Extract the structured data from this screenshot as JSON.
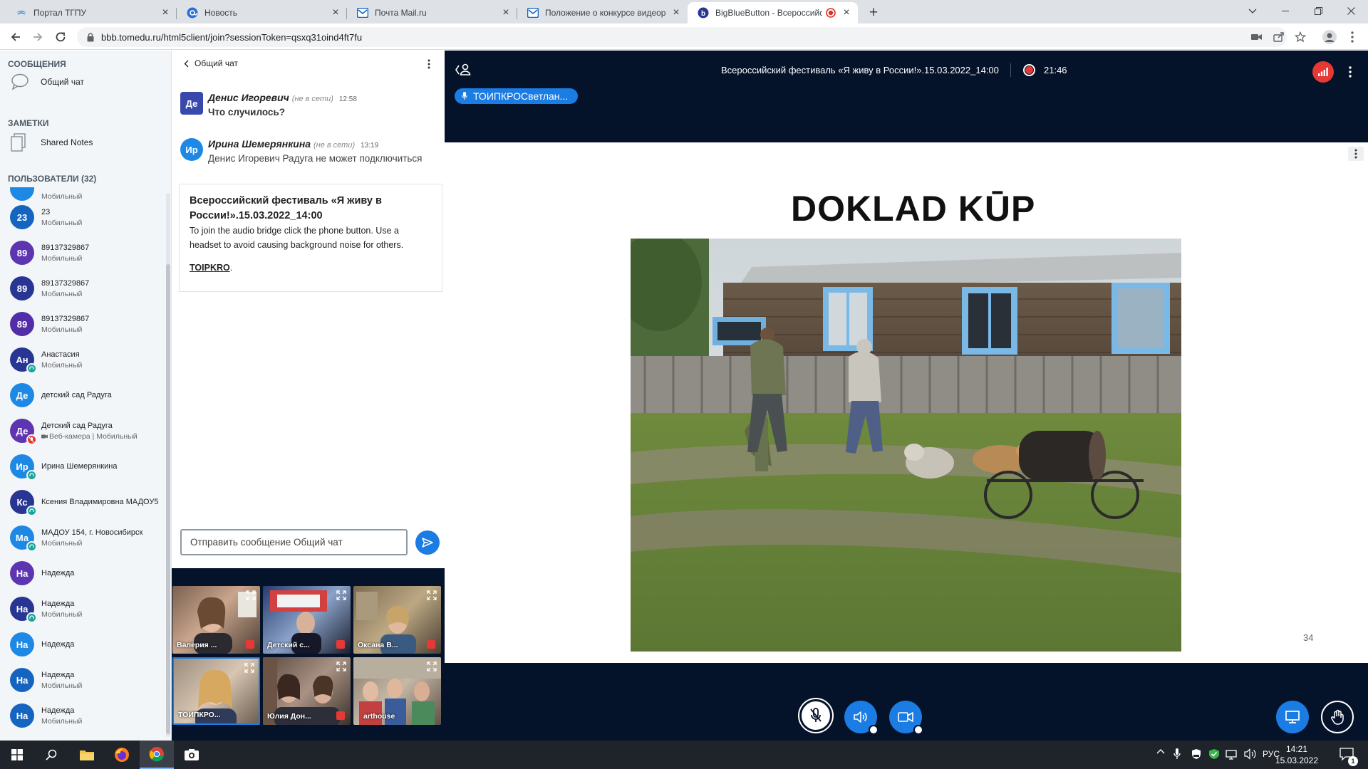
{
  "browser": {
    "tabs": [
      {
        "title": "Портал ТГПУ"
      },
      {
        "title": "Новость"
      },
      {
        "title": "Почта Mail.ru"
      },
      {
        "title": "Положение о конкурсе видеор"
      },
      {
        "title": "BigBlueButton - Всероссийс",
        "active": true
      }
    ],
    "url": "bbb.tomedu.ru/html5client/join?sessionToken=qsxq31oind4ft7fu"
  },
  "sidebar": {
    "messages_header": "СООБЩЕНИЯ",
    "public_chat": "Общий чат",
    "notes_header": "ЗАМЕТКИ",
    "shared_notes": "Shared Notes",
    "users_header": "ПОЛЬЗОВАТЕЛИ (32)",
    "users": [
      {
        "initials": "23",
        "name": "23",
        "status": "Мобильный",
        "color": "#1565c0"
      },
      {
        "initials": "89",
        "name": "89137329867",
        "status": "Мобильный",
        "color": "#5e35b1"
      },
      {
        "initials": "89",
        "name": "89137329867",
        "status": "Мобильный",
        "color": "#283593"
      },
      {
        "initials": "89",
        "name": "89137329867",
        "status": "Мобильный",
        "color": "#512da8"
      },
      {
        "initials": "Ан",
        "name": "Анастасия",
        "status": "Мобильный",
        "color": "#283593",
        "badge": "listen"
      },
      {
        "initials": "Де",
        "name": "детский сад Радуга",
        "status": "",
        "color": "#1e88e5"
      },
      {
        "initials": "Де",
        "name": "Детский сад Радуга",
        "status": "Веб-камера | Мобильный",
        "color": "#5e35b1",
        "badge": "muted"
      },
      {
        "initials": "Ир",
        "name": "Ирина Шемерянкина",
        "status": "",
        "color": "#1e88e5",
        "badge": "listen"
      },
      {
        "initials": "Кс",
        "name": "Ксения Владимировна МАДОУ5",
        "status": "",
        "color": "#283593",
        "badge": "listen"
      },
      {
        "initials": "Ма",
        "name": "МАДОУ 154, г. Новосибирск",
        "status": "Мобильный",
        "color": "#1e88e5",
        "badge": "listen"
      },
      {
        "initials": "На",
        "name": "Надежда",
        "status": "",
        "color": "#5e35b1"
      },
      {
        "initials": "На",
        "name": "Надежда",
        "status": "Мобильный",
        "color": "#283593",
        "badge": "listen"
      },
      {
        "initials": "На",
        "name": "Надежда",
        "status": "",
        "color": "#1e88e5"
      },
      {
        "initials": "На",
        "name": "Надежда",
        "status": "Мобильный",
        "color": "#1565c0"
      },
      {
        "initials": "На",
        "name": "Надежда",
        "status": "Мобильный",
        "color": "#1565c0"
      }
    ],
    "partial_user_status": "Мобильный"
  },
  "chat": {
    "title": "Общий чат",
    "messages": [
      {
        "initials": "Де",
        "author": "Денис Игоревич",
        "offline": "(не в сети)",
        "time": "12:58",
        "text": "Что случилось?",
        "color": "#3949ab"
      },
      {
        "initials": "Ир",
        "author": "Ирина Шемерянкина",
        "offline": "(не в сети)",
        "time": "13:19",
        "text": "Денис Игоревич Радуга не может подключиться",
        "color": "#1e88e5"
      }
    ],
    "welcome": {
      "title": "Всероссийский фестиваль «Я живу в России!».15.03.2022_14:00",
      "body": "To join the audio bridge click the phone button. Use a headset to avoid causing background noise for others.",
      "link": "TOIPKRO",
      "link_suffix": "."
    },
    "input_placeholder": "Отправить сообщение Общий чат"
  },
  "videos": [
    {
      "name": "Валерия ..."
    },
    {
      "name": "Детский с..."
    },
    {
      "name": "Оксана В..."
    },
    {
      "name": "ТОИПКРО..."
    },
    {
      "name": "Юлия Дон..."
    },
    {
      "name": "arthouse"
    }
  ],
  "meeting": {
    "title": "Всероссийский фестиваль «Я живу в России!».15.03.2022_14:00",
    "recording_time": "21:46",
    "talking": "ТОИПКРОСветлан..."
  },
  "slide": {
    "title": "DOKLAD KŪP",
    "page": "34"
  },
  "taskbar": {
    "lang": "РУС",
    "time": "14:21",
    "date": "15.03.2022",
    "notifications": "1"
  },
  "colors": {
    "accent": "#1b7ce3",
    "dark": "#05132a",
    "record": "#e53935"
  }
}
